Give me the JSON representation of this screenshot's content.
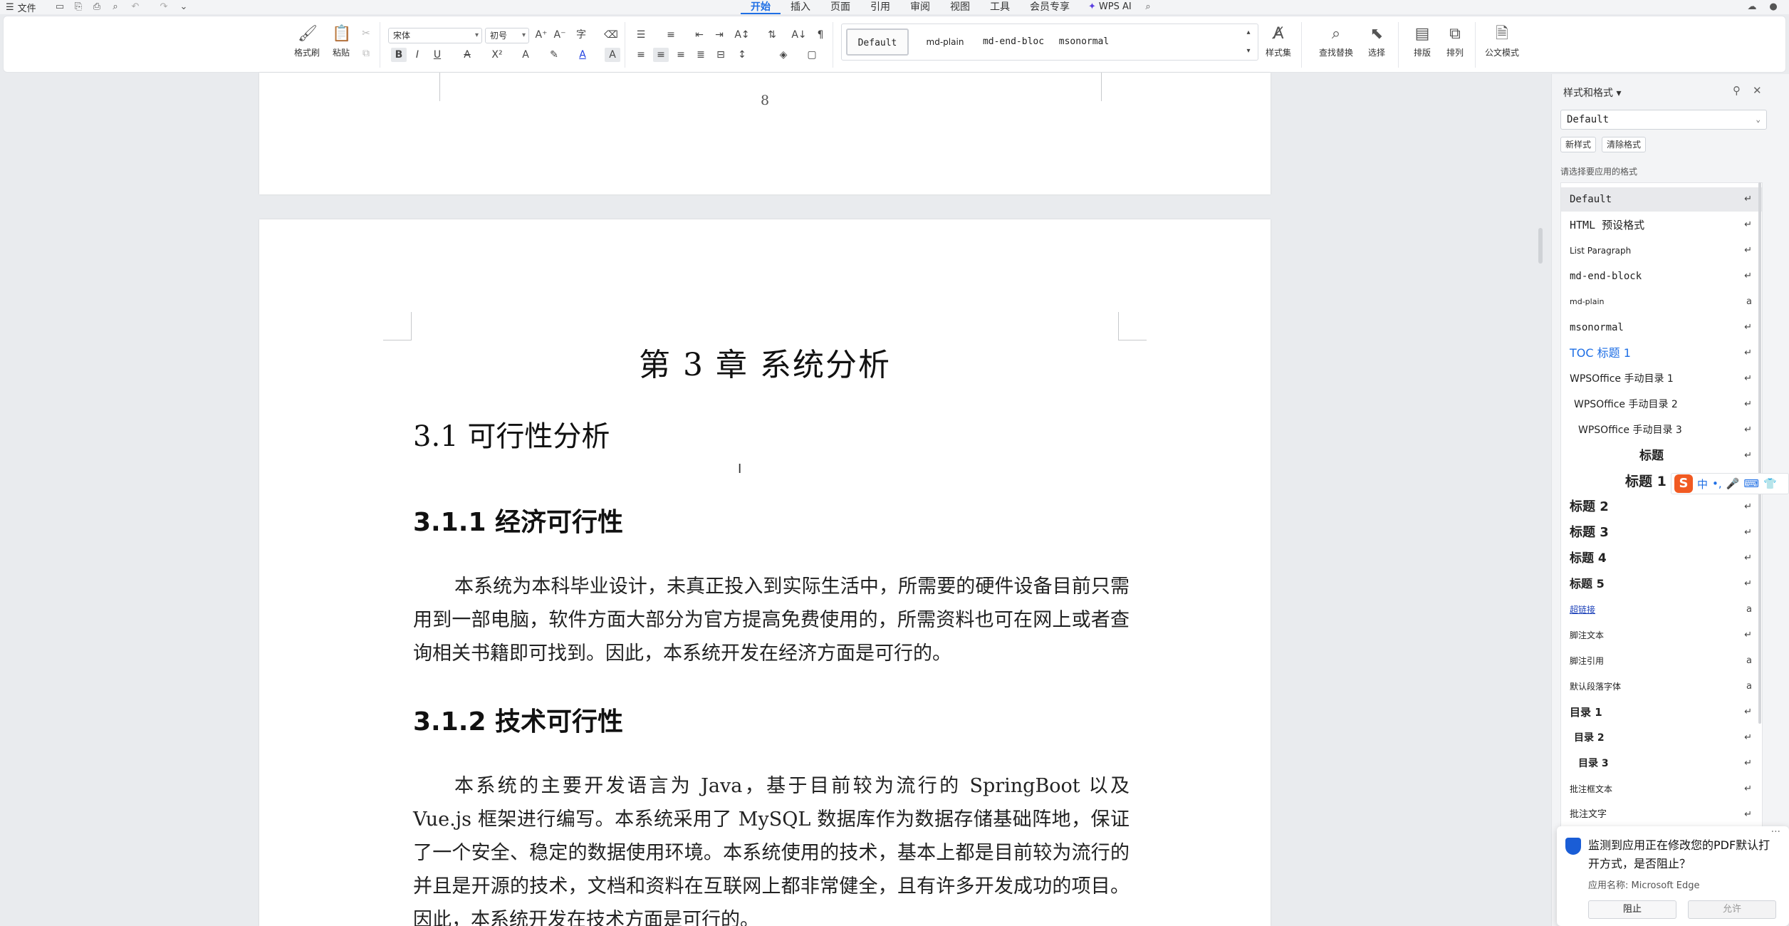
{
  "menubar": {
    "file_label": "文件",
    "tabs": [
      "开始",
      "插入",
      "页面",
      "引用",
      "审阅",
      "视图",
      "工具",
      "会员专享"
    ],
    "active_tab": "开始",
    "wps_ai_label": "WPS AI"
  },
  "ribbon": {
    "format_painter_label": "格式刷",
    "paste_label": "粘贴",
    "font_name": "宋体",
    "font_size": "初号",
    "style_gallery": [
      "Default",
      "md-plain",
      "md-end-bloc",
      "msonormal"
    ],
    "style_set_label": "样式集",
    "find_replace_label": "查找替换",
    "select_label": "选择",
    "layout_label": "排版",
    "arrange_label": "排列",
    "official_label": "公文模式"
  },
  "document": {
    "page_number": "8",
    "chapter_title": "第 3 章  系统分析",
    "section_title": "3.1  可行性分析",
    "sub1_title": "3.1.1  经济可行性",
    "sub1_para": "本系统为本科毕业设计，未真正投入到实际生活中，所需要的硬件设备目前只需用到一部电脑，软件方面大部分为官方提高免费使用的，所需资料也可在网上或者查询相关书籍即可找到。因此，本系统开发在经济方面是可行的。",
    "sub2_title": "3.1.2  技术可行性",
    "sub2_para": "本系统的主要开发语言为 Java，基于目前较为流行的 SpringBoot 以及 Vue.js 框架进行编写。本系统采用了 MySQL 数据库作为数据存储基础阵地，保证了一个安全、稳定的数据使用环境。本系统使用的技术，基本上都是目前较为流行的并且是开源的技术，文档和资料在互联网上都非常健全，且有许多开发成功的项目。因此，本系统开发在技术方面是可行的。"
  },
  "style_panel": {
    "title": "样式和格式",
    "current_style": "Default",
    "new_style_label": "新样式",
    "clear_format_label": "清除格式",
    "hint": "请选择要应用的格式",
    "items": [
      {
        "label": "Default",
        "mark": "↵"
      },
      {
        "label": "HTML 预设格式",
        "mark": "↵"
      },
      {
        "label": "List Paragraph",
        "mark": "↵"
      },
      {
        "label": "md-end-block",
        "mark": "↵"
      },
      {
        "label": "md-plain",
        "mark": "a"
      },
      {
        "label": "msonormal",
        "mark": "↵"
      },
      {
        "label": "TOC 标题 1",
        "mark": "↵"
      },
      {
        "label": "WPSOffice 手动目录 1",
        "mark": "↵"
      },
      {
        "label": "WPSOffice 手动目录 2",
        "mark": "↵"
      },
      {
        "label": "WPSOffice 手动目录 3",
        "mark": "↵"
      },
      {
        "label": "标题",
        "mark": "↵"
      },
      {
        "label": "标题 1",
        "mark": "↵"
      },
      {
        "label": "标题 2",
        "mark": "↵"
      },
      {
        "label": "标题 3",
        "mark": "↵"
      },
      {
        "label": "标题 4",
        "mark": "↵"
      },
      {
        "label": "标题 5",
        "mark": "↵"
      },
      {
        "label": "超链接",
        "mark": "a"
      },
      {
        "label": "脚注文本",
        "mark": "↵"
      },
      {
        "label": "脚注引用",
        "mark": "a"
      },
      {
        "label": "默认段落字体",
        "mark": "a"
      },
      {
        "label": "目录 1",
        "mark": "↵"
      },
      {
        "label": "目录 2",
        "mark": "↵"
      },
      {
        "label": "目录 3",
        "mark": "↵"
      },
      {
        "label": "批注框文本",
        "mark": "↵"
      },
      {
        "label": "批注文字",
        "mark": "↵"
      }
    ]
  },
  "ime": {
    "mode": "中"
  },
  "toast": {
    "message": "监测到应用正在修改您的PDF默认打开方式，是否阻止？",
    "app_name": "应用名称: Microsoft Edge",
    "block_label": "阻止",
    "allow_label": "允许"
  },
  "colors": {
    "accent": "#1f6fe5",
    "toc_blue": "#1f6fe5",
    "link": "#1a3fb8"
  }
}
